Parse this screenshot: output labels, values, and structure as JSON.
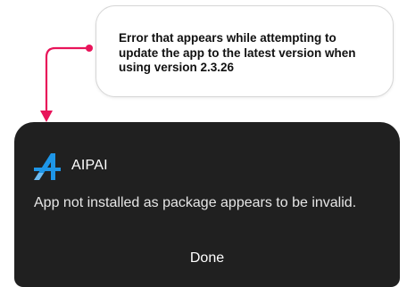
{
  "annotation": {
    "text": "Error that appears while attempting to update the app to the latest version when using version 2.3.26",
    "accent_color": "#e8145a"
  },
  "dialog": {
    "app_icon": "aipai-logo-icon",
    "app_name": "AIPAI",
    "message": "App not installed as package appears to be invalid.",
    "done_label": "Done",
    "background_color": "#202020",
    "logo_color": "#1e96e8"
  }
}
